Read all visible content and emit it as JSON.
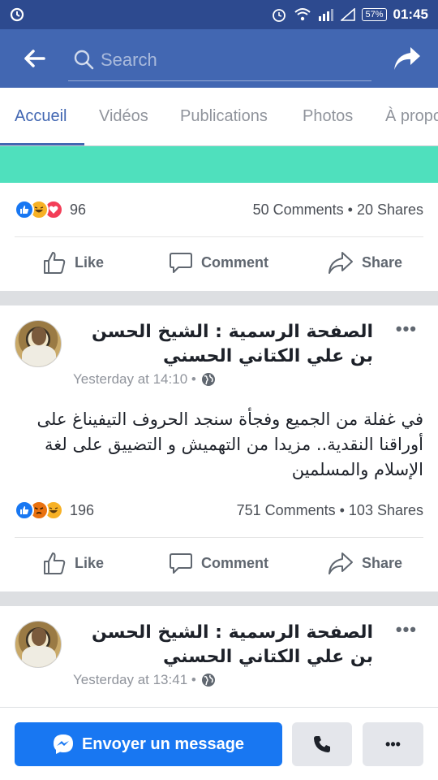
{
  "status": {
    "battery": "57%",
    "time": "01:45"
  },
  "header": {
    "search_placeholder": "Search"
  },
  "tabs": [
    {
      "label": "Accueil"
    },
    {
      "label": "Vidéos"
    },
    {
      "label": "Publications"
    },
    {
      "label": "Photos"
    },
    {
      "label": "À propos"
    }
  ],
  "posts": [
    {
      "reaction_count": "96",
      "stats": "50 Comments • 20 Shares",
      "actions": {
        "like": "Like",
        "comment": "Comment",
        "share": "Share"
      }
    },
    {
      "author": "الصفحة الرسمية : الشيخ الحسن بن علي الكتاني الحسني",
      "time": "Yesterday at 14:10 •",
      "body": "في غفلة من الجميع وفجأة سنجد الحروف التيفيناغ على أوراقنا النقدية.. مزيدا من التهميش و التضييق على لغة الإسلام والمسلمين",
      "reaction_count": "196",
      "stats": "751 Comments • 103 Shares",
      "actions": {
        "like": "Like",
        "comment": "Comment",
        "share": "Share"
      }
    },
    {
      "author": "الصفحة الرسمية : الشيخ الحسن بن علي الكتاني الحسني",
      "time": "Yesterday at 13:41 •"
    }
  ],
  "bottom": {
    "message_button": "Envoyer un message"
  },
  "colors": {
    "brand": "#4267b2",
    "status_bar": "#2d4a8f",
    "messenger_blue": "#1877f2",
    "teal_strip": "#4fe0bd"
  }
}
